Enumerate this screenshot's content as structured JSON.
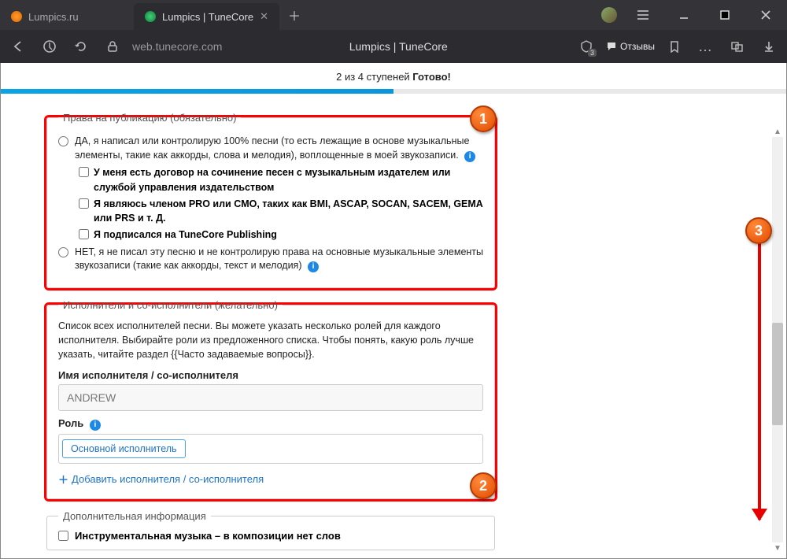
{
  "browser": {
    "tabs": [
      {
        "title": "Lumpics.ru"
      },
      {
        "title": "Lumpics | TuneCore"
      }
    ],
    "url": "web.tunecore.com",
    "page_title": "Lumpics | TuneCore",
    "bookmark_badge": "3",
    "reviews_label": "Отзывы"
  },
  "progress": {
    "prefix": "2 из 4 ступеней ",
    "bold": "Готово!"
  },
  "rights": {
    "legend": "Права на публикацию (обязательно)",
    "yes": "ДА, я написал или контролирую 100% песни (то есть лежащие в основе музыкальные элементы, такие как аккорды, слова и мелодия), воплощенные в моей звукозаписи.",
    "cb1": "У меня есть договор на сочинение песен с музыкальным издателем или службой управления издательством",
    "cb2": "Я являюсь членом PRO или CMO, таких как BMI, ASCAP, SOCAN, SACEM, GEMA или PRS и т. Д.",
    "cb3": "Я подписался на TuneCore Publishing",
    "no": "НЕТ, я не писал эту песню и не контролирую права на основные музыкальные элементы звукозаписи (такие как аккорды, текст и мелодия)"
  },
  "artists": {
    "legend": "Исполнители и со-исполнители (желательно)",
    "desc": "Список всех исполнителей песни. Вы можете указать несколько ролей для каждого исполнителя. Выбирайте роли из предложенного списка. Чтобы понять, какую роль лучше указать, читайте раздел {{Часто задаваемые вопросы}}.",
    "name_label": "Имя исполнителя / со-исполнителя",
    "name_value": "ANDREW",
    "role_label": "Роль",
    "role_tag": "Основной исполнитель",
    "add_link": "Добавить исполнителя / со-исполнителя"
  },
  "extra": {
    "legend": "Дополнительная информация",
    "instrumental": "Инструментальная музыка – в композиции нет слов"
  },
  "callouts": {
    "c1": "1",
    "c2": "2",
    "c3": "3"
  }
}
